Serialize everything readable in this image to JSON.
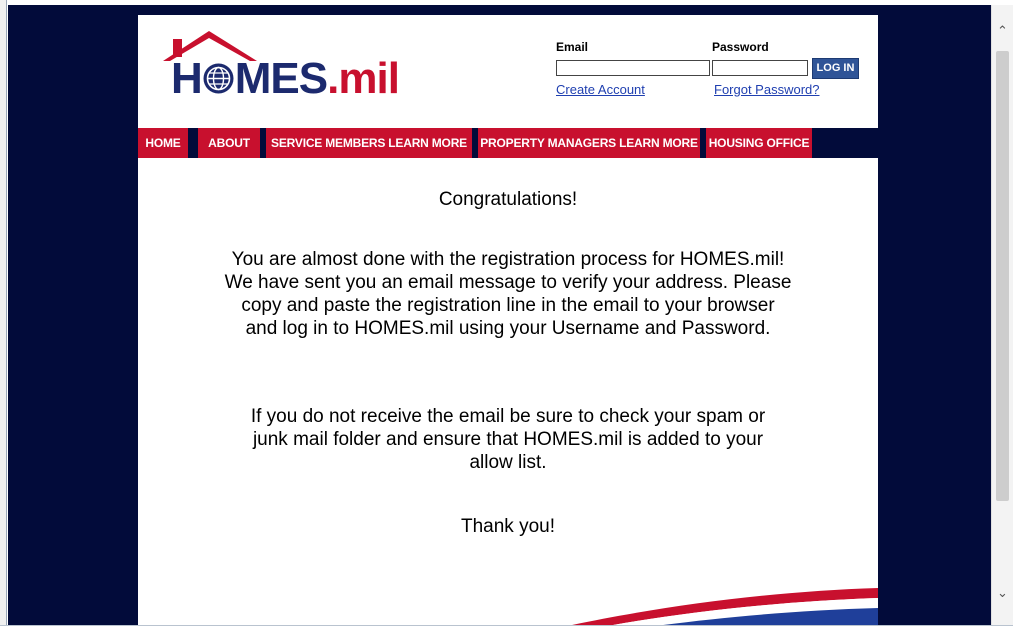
{
  "site": {
    "logo_main": "H",
    "logo_globe": "⊕",
    "logo_rest": "MES",
    "logo_suffix": ".mil"
  },
  "login": {
    "email_label": "Email",
    "password_label": "Password",
    "email_value": "",
    "password_value": "",
    "login_button": "LOG IN",
    "create_account": "Create Account",
    "forgot_password": "Forgot Password?"
  },
  "nav": {
    "items": [
      {
        "label": "HOME"
      },
      {
        "label": "ABOUT"
      },
      {
        "label": "SERVICE MEMBERS LEARN MORE"
      },
      {
        "label": "PROPERTY MANAGERS LEARN MORE"
      },
      {
        "label": "HOUSING OFFICE"
      }
    ]
  },
  "content": {
    "heading": "Congratulations!",
    "paragraph1": "You are almost done with the registration process for HOMES.mil! We have sent you an email message to verify your address. Please copy and paste the registration line in the email to your browser and log in to HOMES.mil using your Username and Password.",
    "paragraph2": "If you do not receive the email be sure to check your spam or junk mail folder and ensure that HOMES.mil is added to your allow list.",
    "thanks": "Thank you!"
  },
  "colors": {
    "brand_navy": "#020b3a",
    "brand_red": "#c8102e",
    "logo_blue": "#1c2a6e",
    "button_blue": "#2f5497"
  },
  "icons": {
    "scroll_up": "⌃",
    "scroll_down": "⌄"
  }
}
